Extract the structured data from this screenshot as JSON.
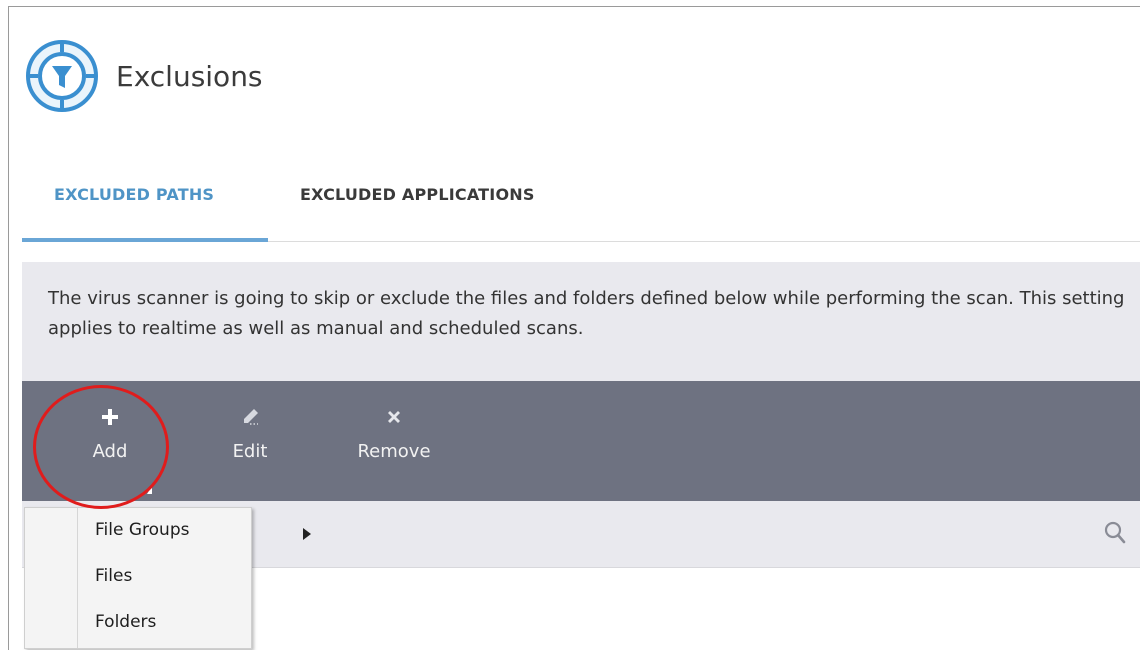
{
  "header": {
    "title": "Exclusions",
    "icon": "exclusions-filter-icon",
    "accent_color": "#3a8fd0"
  },
  "tabs": [
    {
      "label": "EXCLUDED PATHS",
      "active": true
    },
    {
      "label": "EXCLUDED APPLICATIONS",
      "active": false
    }
  ],
  "description": "The virus scanner is going to skip or exclude the files and folders defined below while performing the scan. This setting applies to realtime as well as manual and scheduled scans.",
  "toolbar": {
    "add_label": "Add",
    "edit_label": "Edit",
    "remove_label": "Remove",
    "background_color": "#6e7281"
  },
  "search": {
    "icon": "search-icon"
  },
  "add_menu": {
    "items": [
      {
        "label": "File Groups",
        "has_submenu": true
      },
      {
        "label": "Files",
        "has_submenu": false
      },
      {
        "label": "Folders",
        "has_submenu": false
      }
    ]
  },
  "highlight": {
    "color": "#e01c1c",
    "target": "Add"
  }
}
